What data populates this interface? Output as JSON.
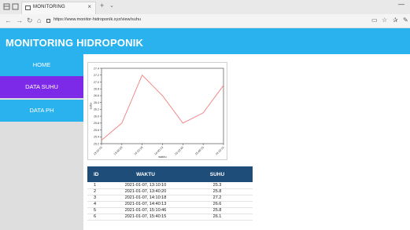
{
  "browser": {
    "tab_title": "MONITORING",
    "url": "https://www.monitor-hidroponik.xyz/view/suhu"
  },
  "app": {
    "title": "MONITORING HIDROPONIK"
  },
  "sidebar": {
    "items": [
      {
        "label": "HOME"
      },
      {
        "label": "DATA SUHU"
      },
      {
        "label": "DATA PH"
      }
    ],
    "active_index": 1
  },
  "chart_data": {
    "type": "line",
    "xlabel": "waktu",
    "ylabel": "suhu",
    "x": [
      "13:10:10",
      "13:40:20",
      "14:10:18",
      "14:40:13",
      "15:10:46",
      "15:40:15",
      "16:10:16"
    ],
    "series": [
      {
        "values": [
          25.3,
          25.8,
          27.2,
          26.6,
          25.8,
          26.1,
          26.9
        ],
        "color": "#f07f7f"
      }
    ],
    "ylim": [
      25.2,
      27.4
    ],
    "yticks": [
      "25.2",
      "25.4",
      "25.6",
      "25.8",
      "26.0",
      "26.2",
      "26.4",
      "26.6",
      "26.8",
      "27.0",
      "27.2",
      "27.4"
    ],
    "grid": false
  },
  "table": {
    "headers": {
      "id": "ID",
      "waktu": "WAKTU",
      "suhu": "SUHU"
    },
    "rows": [
      {
        "id": "1",
        "waktu": "2021-01-07, 13:10:10",
        "suhu": "25.3"
      },
      {
        "id": "2",
        "waktu": "2021-01-07, 13:40:20",
        "suhu": "25.8"
      },
      {
        "id": "3",
        "waktu": "2021-01-07, 14:10:18",
        "suhu": "27.2"
      },
      {
        "id": "4",
        "waktu": "2021-01-07, 14:40:13",
        "suhu": "26.6"
      },
      {
        "id": "5",
        "waktu": "2021-01-07, 15:10:46",
        "suhu": "25.8"
      },
      {
        "id": "6",
        "waktu": "2021-01-07, 15:40:15",
        "suhu": "26.1"
      }
    ]
  }
}
